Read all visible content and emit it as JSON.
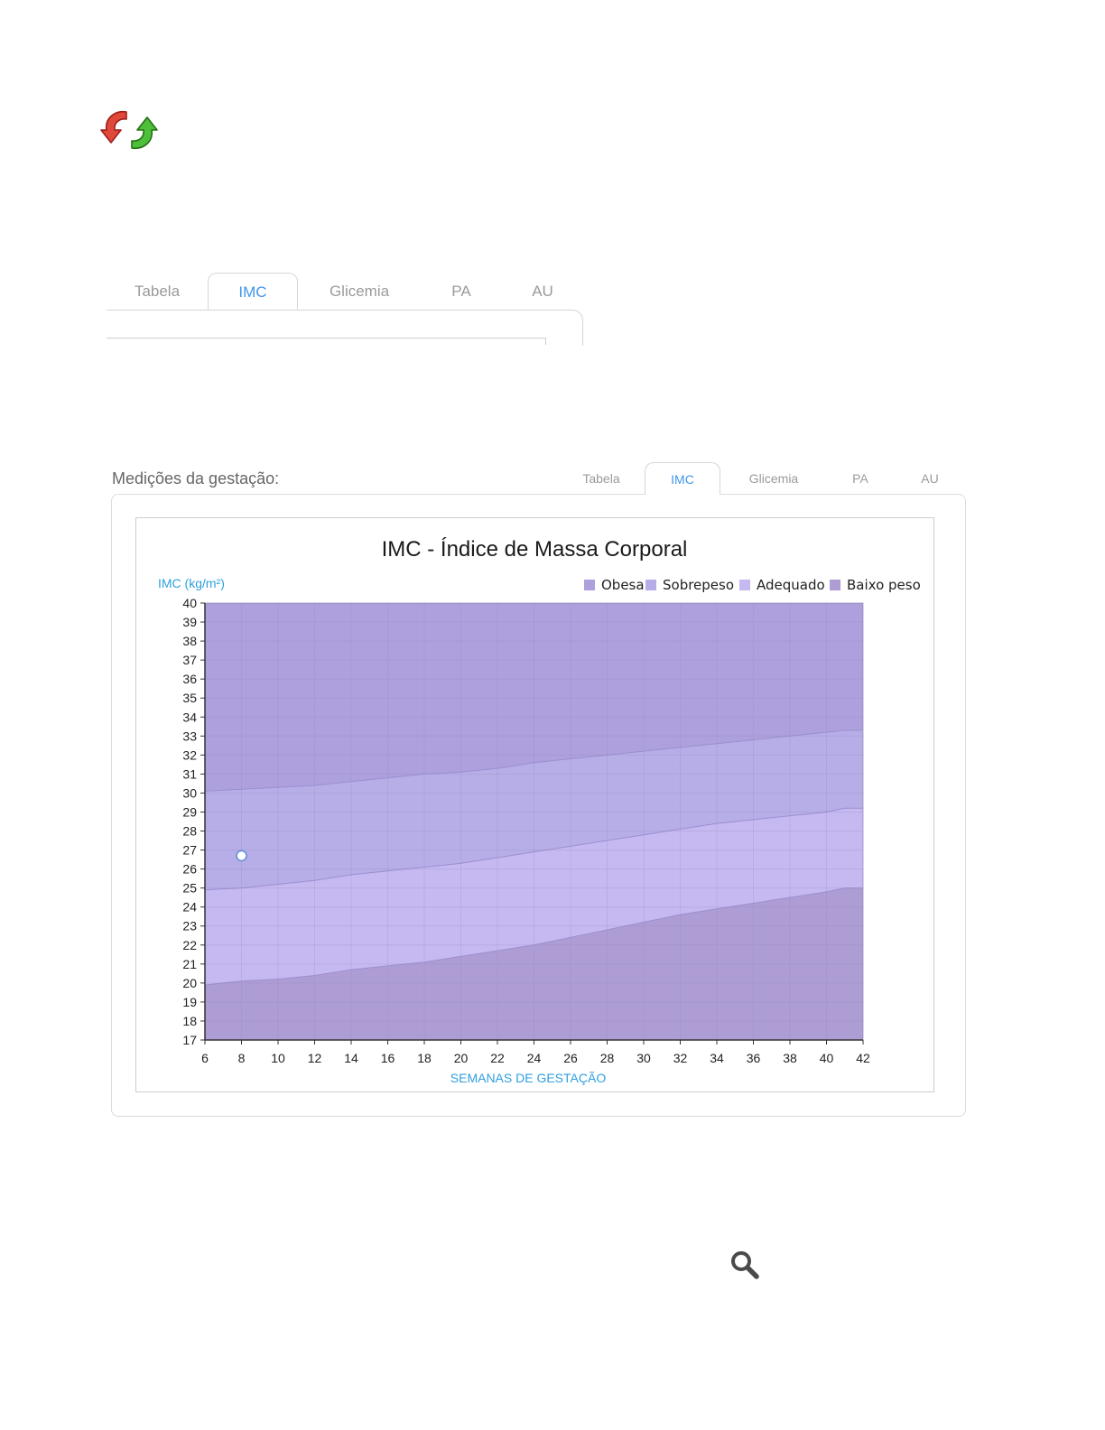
{
  "icons": {
    "refresh": "refresh-icon",
    "search": "search-icon"
  },
  "tabs_top": [
    {
      "label": "Tabela",
      "active": false
    },
    {
      "label": "IMC",
      "active": true
    },
    {
      "label": "Glicemia",
      "active": false
    },
    {
      "label": "PA",
      "active": false
    },
    {
      "label": "AU",
      "active": false
    }
  ],
  "panel": {
    "label": "Medições da gestação:",
    "tabs": [
      {
        "label": "Tabela",
        "active": false
      },
      {
        "label": "IMC",
        "active": true
      },
      {
        "label": "Glicemia",
        "active": false
      },
      {
        "label": "PA",
        "active": false
      },
      {
        "label": "AU",
        "active": false
      }
    ]
  },
  "colors": {
    "tab_active": "#3f96e8",
    "tab_inactive": "#9a9a9a",
    "axis_title": "#2f9fe0",
    "obesa": "#aea0dc",
    "sobrepeso": "#b7aee7",
    "adequado": "#c6b8f0",
    "baixo_peso": "#ae9dd4",
    "patient_point": "#ffffff"
  },
  "chart_data": {
    "type": "area",
    "title": "IMC - Índice de Massa Corporal",
    "xlabel": "SEMANAS DE GESTAÇÃO",
    "ylabel": "IMC (kg/m²)",
    "xlim": [
      6,
      42
    ],
    "ylim": [
      17,
      40
    ],
    "xticks": [
      6,
      8,
      10,
      12,
      14,
      16,
      18,
      20,
      22,
      24,
      26,
      28,
      30,
      32,
      34,
      36,
      38,
      40,
      42
    ],
    "yticks": [
      17,
      18,
      19,
      20,
      21,
      22,
      23,
      24,
      25,
      26,
      27,
      28,
      29,
      30,
      31,
      32,
      33,
      34,
      35,
      36,
      37,
      38,
      39,
      40
    ],
    "grid": true,
    "legend_position": "top-right",
    "legend": [
      "Obesa",
      "Sobrepeso",
      "Adequado",
      "Baixo peso"
    ],
    "x": [
      6,
      8,
      10,
      12,
      14,
      16,
      18,
      20,
      22,
      24,
      26,
      28,
      30,
      32,
      34,
      36,
      38,
      40,
      41,
      42
    ],
    "series": [
      {
        "name": "Obesa",
        "values": [
          40,
          40,
          40,
          40,
          40,
          40,
          40,
          40,
          40,
          40,
          40,
          40,
          40,
          40,
          40,
          40,
          40,
          40,
          40,
          40
        ]
      },
      {
        "name": "Sobrepeso",
        "values": [
          30.1,
          30.2,
          30.3,
          30.4,
          30.6,
          30.8,
          31.0,
          31.1,
          31.3,
          31.6,
          31.8,
          32.0,
          32.2,
          32.4,
          32.6,
          32.8,
          33.0,
          33.2,
          33.3,
          33.3
        ]
      },
      {
        "name": "Adequado",
        "values": [
          24.9,
          25.0,
          25.2,
          25.4,
          25.7,
          25.9,
          26.1,
          26.3,
          26.6,
          26.9,
          27.2,
          27.5,
          27.8,
          28.1,
          28.4,
          28.6,
          28.8,
          29.0,
          29.2,
          29.2
        ]
      },
      {
        "name": "Baixo peso",
        "values": [
          19.9,
          20.1,
          20.2,
          20.4,
          20.7,
          20.9,
          21.1,
          21.4,
          21.7,
          22.0,
          22.4,
          22.8,
          23.2,
          23.6,
          23.9,
          24.2,
          24.5,
          24.8,
          25.0,
          25.0
        ]
      }
    ],
    "points": [
      {
        "x": 8,
        "y": 26.7
      }
    ]
  }
}
